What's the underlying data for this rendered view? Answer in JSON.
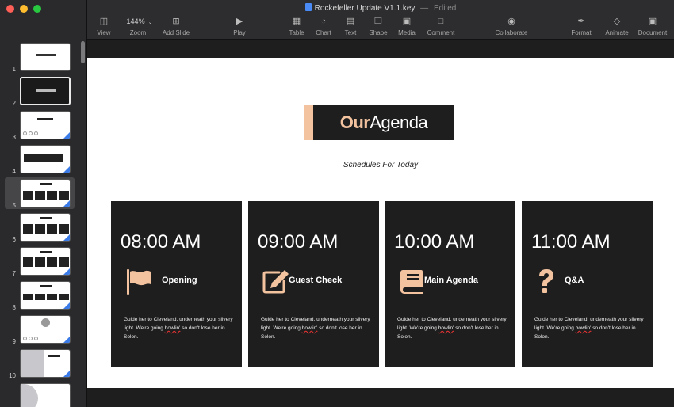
{
  "window": {
    "title": "Rockefeller Update V1.1.key",
    "status": "Edited"
  },
  "toolbar": {
    "view": "View",
    "zoom_value": "144%",
    "zoom": "Zoom",
    "add_slide": "Add Slide",
    "play": "Play",
    "table": "Table",
    "chart": "Chart",
    "text": "Text",
    "shape": "Shape",
    "media": "Media",
    "comment": "Comment",
    "collaborate": "Collaborate",
    "format": "Format",
    "animate": "Animate",
    "document": "Document"
  },
  "sidebar": {
    "slides": [
      {
        "num": "1"
      },
      {
        "num": "2"
      },
      {
        "num": "3"
      },
      {
        "num": "4"
      },
      {
        "num": "5"
      },
      {
        "num": "6"
      },
      {
        "num": "7"
      },
      {
        "num": "8"
      },
      {
        "num": "9"
      },
      {
        "num": "10"
      }
    ],
    "selected": "5"
  },
  "slide": {
    "title_accent": "Our",
    "title_rest": "Agenda",
    "subtitle": "Schedules For Today",
    "accent_color": "#f3c3a0",
    "cards": [
      {
        "time": "08:00 AM",
        "label": "Opening",
        "icon": "flag-icon",
        "body_a": "Guide her to Cleveland, underneath your silvery light. We're going ",
        "body_b": "bowlin'",
        "body_c": " so don't lose her in Solon."
      },
      {
        "time": "09:00 AM",
        "label": "Guest Check",
        "icon": "edit-icon",
        "body_a": "Guide her to Cleveland, underneath your silvery light. We're going ",
        "body_b": "bowlin'",
        "body_c": " so don't lose her in Solon."
      },
      {
        "time": "10:00 AM",
        "label": "Main Agenda",
        "icon": "book-icon",
        "body_a": "Guide her to Cleveland, underneath your silvery light. We're going ",
        "body_b": "bowlin'",
        "body_c": " so don't lose her in Solon."
      },
      {
        "time": "11:00 AM",
        "label": "Q&A",
        "icon": "question-icon",
        "body_a": "Guide her to Cleveland, underneath your silvery light. We're going ",
        "body_b": "bowlin'",
        "body_c": " so don't lose her in Solon."
      }
    ]
  }
}
